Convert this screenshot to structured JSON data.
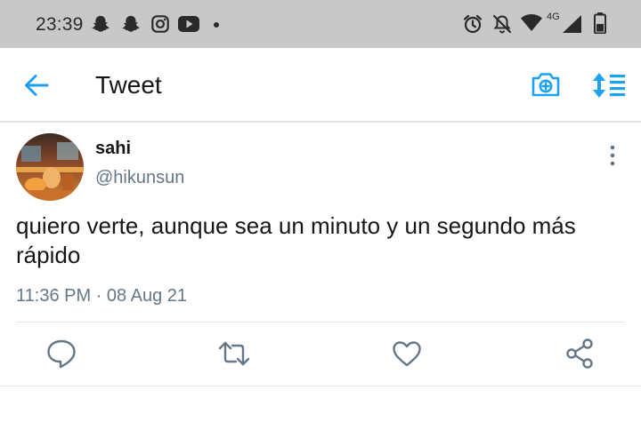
{
  "status_bar": {
    "time": "23:39",
    "network": "4G",
    "notification_icons": [
      "snapchat-icon",
      "snapchat-icon",
      "instagram-icon",
      "youtube-icon",
      "dot-icon"
    ],
    "system_icons": [
      "alarm-icon",
      "mute-icon",
      "wifi-icon",
      "signal-icon",
      "battery-icon"
    ]
  },
  "app_bar": {
    "title": "Tweet",
    "icons": [
      "back-arrow-icon",
      "camera-icon",
      "sort-icon"
    ]
  },
  "tweet": {
    "display_name": "sahi",
    "handle": "@hikunsun",
    "text": "quiero verte, aunque sea un minuto y un segundo más rápido",
    "time": "11:36 PM",
    "separator": "·",
    "date": "08 Aug 21",
    "actions": [
      "reply-icon",
      "retweet-icon",
      "like-icon",
      "share-icon"
    ]
  },
  "colors": {
    "accent": "#1da1f2",
    "status_bar_bg": "#c8c8c8",
    "text_primary": "#14171a",
    "text_secondary": "#657786"
  }
}
